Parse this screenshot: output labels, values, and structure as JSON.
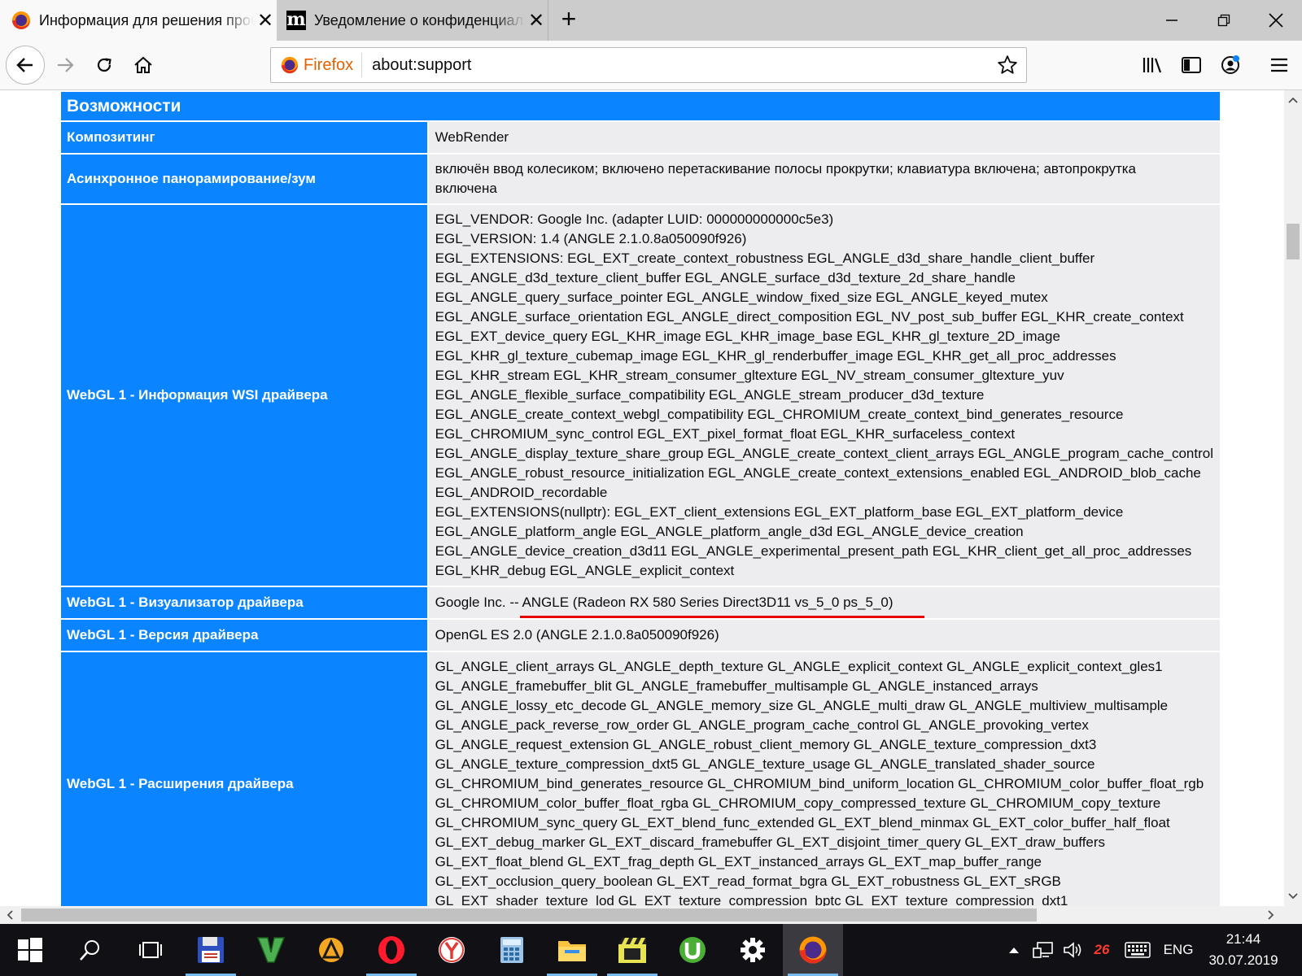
{
  "tabs": [
    {
      "title": "Информация для решения проблем",
      "favicon": "firefox-icon",
      "active": true
    },
    {
      "title": "Уведомление о конфиденциальности",
      "favicon": "m-letter-icon",
      "active": false
    }
  ],
  "nav": {
    "identity_label": "Firefox",
    "url": "about:support"
  },
  "section_title": "Возможности",
  "rows": [
    {
      "key": "Композитинг",
      "lines": [
        "WebRender"
      ]
    },
    {
      "key": "Асинхронное панорамирование/зум",
      "lines": [
        "включён ввод колесиком; включено перетаскивание полосы прокрутки; клавиатура включена; автопрокрутка",
        "включена"
      ]
    },
    {
      "key": "WebGL 1 - Информация WSI драйвера",
      "lines": [
        "EGL_VENDOR: Google Inc. (adapter LUID: 000000000000c5e3)",
        "EGL_VERSION: 1.4 (ANGLE 2.1.0.8a050090f926)",
        "EGL_EXTENSIONS: EGL_EXT_create_context_robustness EGL_ANGLE_d3d_share_handle_client_buffer",
        "EGL_ANGLE_d3d_texture_client_buffer EGL_ANGLE_surface_d3d_texture_2d_share_handle",
        "EGL_ANGLE_query_surface_pointer EGL_ANGLE_window_fixed_size EGL_ANGLE_keyed_mutex",
        "EGL_ANGLE_surface_orientation EGL_ANGLE_direct_composition EGL_NV_post_sub_buffer EGL_KHR_create_context",
        "EGL_EXT_device_query EGL_KHR_image EGL_KHR_image_base EGL_KHR_gl_texture_2D_image",
        "EGL_KHR_gl_texture_cubemap_image EGL_KHR_gl_renderbuffer_image EGL_KHR_get_all_proc_addresses",
        "EGL_KHR_stream EGL_KHR_stream_consumer_gltexture EGL_NV_stream_consumer_gltexture_yuv",
        "EGL_ANGLE_flexible_surface_compatibility EGL_ANGLE_stream_producer_d3d_texture",
        "EGL_ANGLE_create_context_webgl_compatibility EGL_CHROMIUM_create_context_bind_generates_resource",
        "EGL_CHROMIUM_sync_control EGL_EXT_pixel_format_float EGL_KHR_surfaceless_context",
        "EGL_ANGLE_display_texture_share_group EGL_ANGLE_create_context_client_arrays EGL_ANGLE_program_cache_control",
        "EGL_ANGLE_robust_resource_initialization EGL_ANGLE_create_context_extensions_enabled EGL_ANDROID_blob_cache",
        "EGL_ANDROID_recordable",
        "EGL_EXTENSIONS(nullptr): EGL_EXT_client_extensions EGL_EXT_platform_base EGL_EXT_platform_device",
        "EGL_ANGLE_platform_angle EGL_ANGLE_platform_angle_d3d EGL_ANGLE_device_creation",
        "EGL_ANGLE_device_creation_d3d11 EGL_ANGLE_experimental_present_path EGL_KHR_client_get_all_proc_addresses",
        "EGL_KHR_debug EGL_ANGLE_explicit_context"
      ]
    },
    {
      "key": "WebGL 1 - Визуализатор драйвера",
      "lines": [
        "Google Inc. -- ANGLE (Radeon RX 580 Series Direct3D11 vs_5_0 ps_5_0)"
      ]
    },
    {
      "key": "WebGL 1 - Версия драйвера",
      "lines": [
        "OpenGL ES 2.0 (ANGLE 2.1.0.8a050090f926)"
      ]
    },
    {
      "key": "WebGL 1 - Расширения драйвера",
      "lines": [
        "GL_ANGLE_client_arrays GL_ANGLE_depth_texture GL_ANGLE_explicit_context GL_ANGLE_explicit_context_gles1",
        "GL_ANGLE_framebuffer_blit GL_ANGLE_framebuffer_multisample GL_ANGLE_instanced_arrays",
        "GL_ANGLE_lossy_etc_decode GL_ANGLE_memory_size GL_ANGLE_multi_draw GL_ANGLE_multiview_multisample",
        "GL_ANGLE_pack_reverse_row_order GL_ANGLE_program_cache_control GL_ANGLE_provoking_vertex",
        "GL_ANGLE_request_extension GL_ANGLE_robust_client_memory GL_ANGLE_texture_compression_dxt3",
        "GL_ANGLE_texture_compression_dxt5 GL_ANGLE_texture_usage GL_ANGLE_translated_shader_source",
        "GL_CHROMIUM_bind_generates_resource GL_CHROMIUM_bind_uniform_location GL_CHROMIUM_color_buffer_float_rgb",
        "GL_CHROMIUM_color_buffer_float_rgba GL_CHROMIUM_copy_compressed_texture GL_CHROMIUM_copy_texture",
        "GL_CHROMIUM_sync_query GL_EXT_blend_func_extended GL_EXT_blend_minmax GL_EXT_color_buffer_half_float",
        "GL_EXT_debug_marker GL_EXT_discard_framebuffer GL_EXT_disjoint_timer_query GL_EXT_draw_buffers",
        "GL_EXT_float_blend GL_EXT_frag_depth GL_EXT_instanced_arrays GL_EXT_map_buffer_range",
        "GL_EXT_occlusion_query_boolean GL_EXT_read_format_bgra GL_EXT_robustness GL_EXT_sRGB",
        "GL_EXT_shader_texture_lod GL_EXT_texture_compression_bptc GL_EXT_texture_compression_dxt1"
      ]
    }
  ],
  "taskbar": {
    "apps": [
      "start-icon",
      "search-icon",
      "task-view-icon",
      "save-disk-icon",
      "gta-v-icon",
      "aimp-icon",
      "opera-icon",
      "yandex-browser-icon",
      "calculator-icon",
      "file-explorer-icon",
      "video-editor-icon",
      "utorrent-icon",
      "settings-icon",
      "firefox-icon"
    ],
    "tray_badge": "26",
    "language": "ENG",
    "time": "21:44",
    "date": "30.07.2019"
  },
  "colors": {
    "accent": "#0a84ff",
    "row_value_bg": "#ededf0",
    "highlight_underline": "#e80000"
  }
}
